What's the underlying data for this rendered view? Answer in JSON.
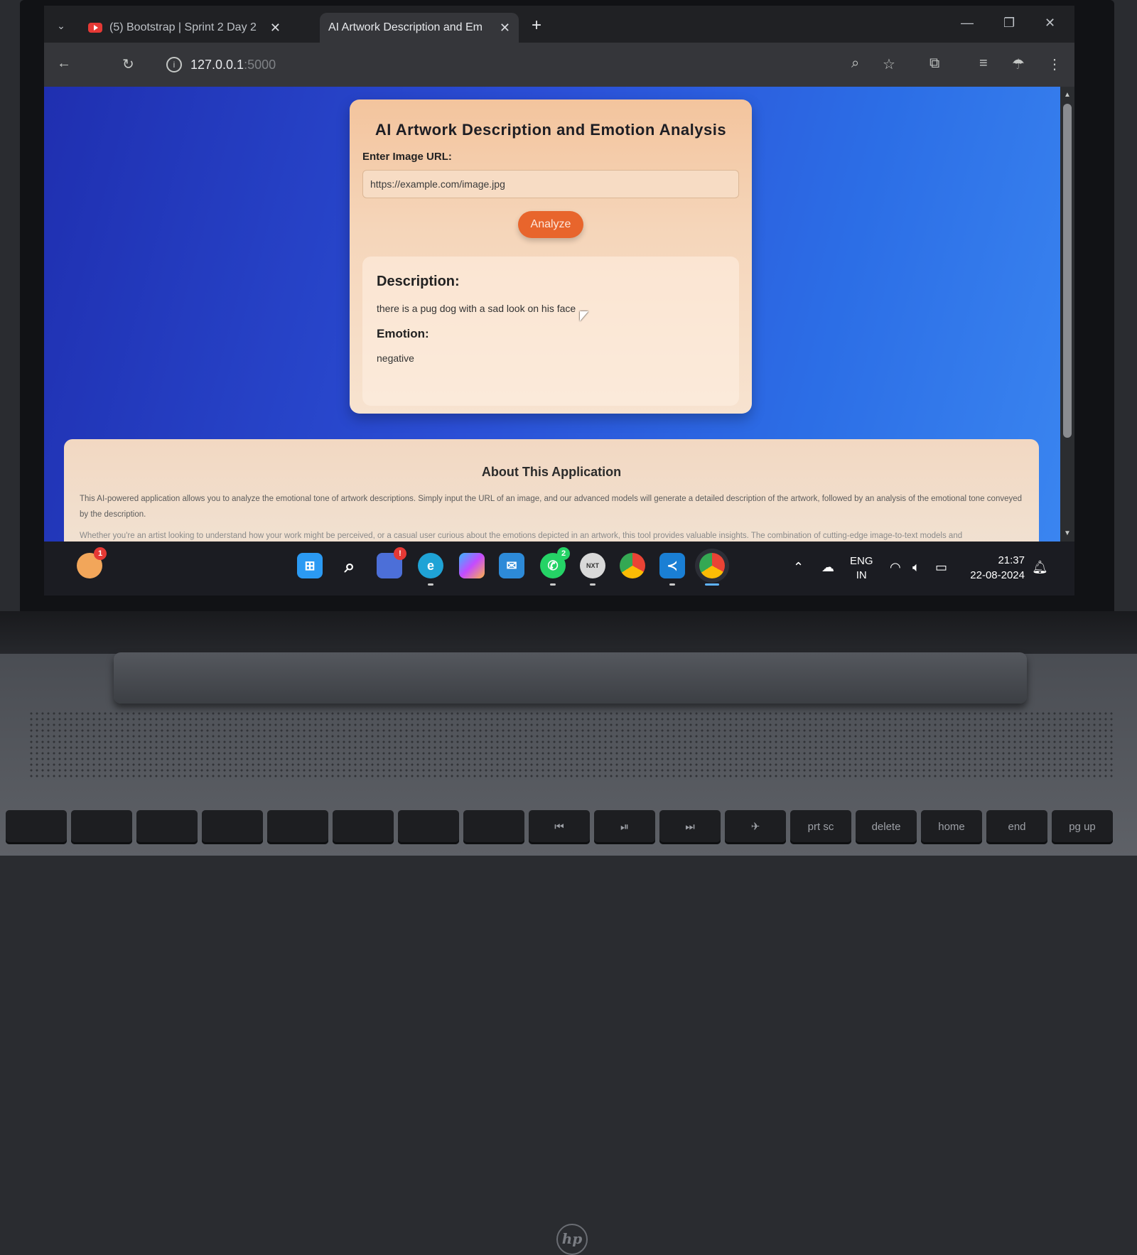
{
  "browser": {
    "tabs": [
      {
        "title": "(5) Bootstrap | Sprint 2 Day 2",
        "close": "✕"
      },
      {
        "title": "AI Artwork Description and Em",
        "close": "✕"
      }
    ],
    "new_tab": "+",
    "tab_list": "⌄",
    "url_host": "127.0.0.1",
    "url_port": ":5000",
    "window_controls": {
      "minimize": "—",
      "restore": "❐",
      "close": "✕"
    }
  },
  "app": {
    "title": "AI Artwork Description and Emotion Analysis",
    "url_label": "Enter Image URL:",
    "url_value": "https://example.com/image.jpg",
    "analyze_label": "Analyze",
    "description_heading": "Description:",
    "description_text": "there is a pug dog with a sad look on his face",
    "emotion_heading": "Emotion:",
    "emotion_text": "negative"
  },
  "about": {
    "title": "About This Application",
    "paragraph1": "This AI-powered application allows you to analyze the emotional tone of artwork descriptions. Simply input the URL of an image, and our advanced models will generate a detailed description of the artwork, followed by an analysis of the emotional tone conveyed by the description.",
    "paragraph2": "Whether you're an artist looking to understand how your work might be perceived, or a casual user curious about the emotions depicted in an artwork, this tool provides valuable insights. The combination of cutting-edge image-to-text models and"
  },
  "taskbar": {
    "notif_badge": "1",
    "teams_badge": "!",
    "whatsapp_badge": "2",
    "lang_line1": "ENG",
    "lang_line2": "IN",
    "time": "21:37",
    "date": "22-08-2024"
  },
  "keyboard": {
    "keys": [
      "",
      "",
      "",
      "",
      "",
      "",
      "",
      "",
      "⏮",
      "⏯",
      "⏭",
      "✈",
      "prt sc",
      "delete",
      "home",
      "end",
      "pg up"
    ]
  },
  "laptop_brand": "hp"
}
